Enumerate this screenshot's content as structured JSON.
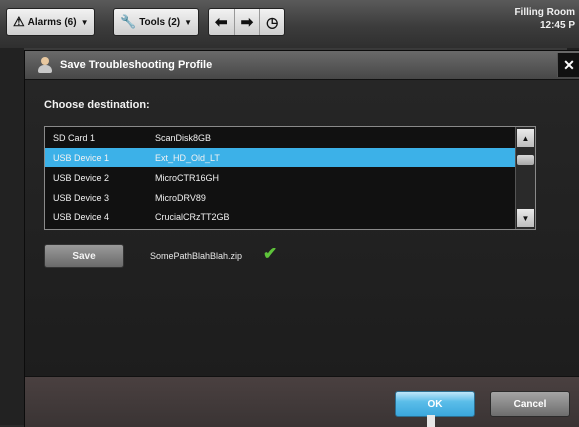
{
  "toolbar": {
    "alarms_label": "Alarms (6)",
    "tools_label": "Tools (2)",
    "location": "Filling Room",
    "time": "12:45 P"
  },
  "dialog": {
    "title": "Save Troubleshooting Profile",
    "choose_label": "Choose destination:",
    "devices": [
      {
        "name": "SD Card 1",
        "label": "ScanDisk8GB",
        "selected": false
      },
      {
        "name": "USB Device 1",
        "label": "Ext_HD_Old_LT",
        "selected": true
      },
      {
        "name": "USB Device 2",
        "label": "MicroCTR16GH",
        "selected": false
      },
      {
        "name": "USB Device 3",
        "label": "MicroDRV89",
        "selected": false
      },
      {
        "name": "USB Device 4",
        "label": "CrucialCRzTT2GB",
        "selected": false
      }
    ],
    "save_label": "Save",
    "saved_file": "SomePathBlahBlah.zip",
    "ok_label": "OK",
    "cancel_label": "Cancel"
  },
  "colors": {
    "selection": "#3cb1e8",
    "success": "#5ec33a"
  }
}
